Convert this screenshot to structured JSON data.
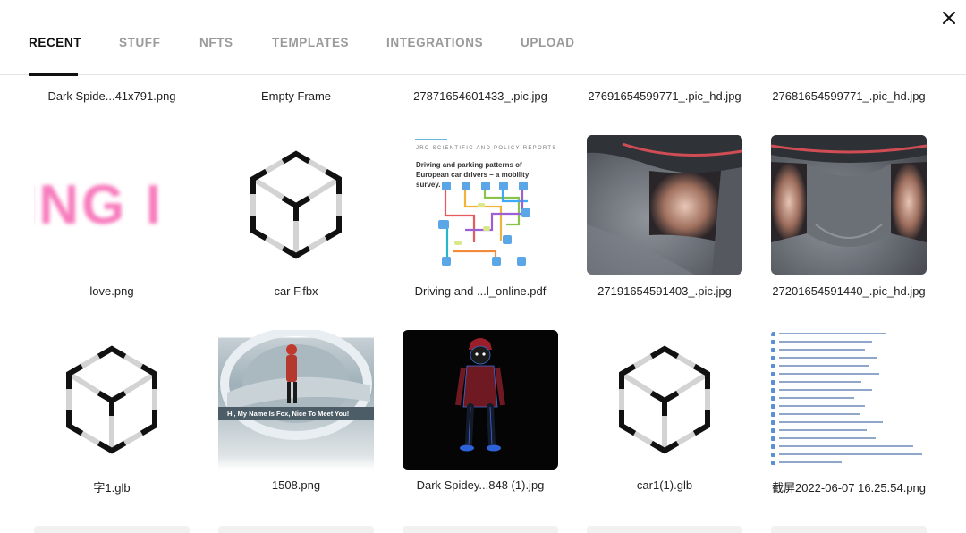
{
  "tabs": [
    {
      "label": "RECENT",
      "active": true
    },
    {
      "label": "STUFF",
      "active": false
    },
    {
      "label": "NFTS",
      "active": false
    },
    {
      "label": "TEMPLATES",
      "active": false
    },
    {
      "label": "INTEGRATIONS",
      "active": false
    },
    {
      "label": "UPLOAD",
      "active": false
    }
  ],
  "close_icon": "close-icon",
  "top_labels": [
    "Dark Spide...41x791.png",
    "Empty Frame",
    "27871654601433_.pic.jpg",
    "27691654599771_.pic_hd.jpg",
    "27681654599771_.pic_hd.jpg"
  ],
  "files_row1": [
    {
      "name": "love.png",
      "thumb_text": "ING I"
    },
    {
      "name": "car F.fbx",
      "icon": "3d-model-icon"
    },
    {
      "name": "Driving and ...l_online.pdf",
      "pdf_header": "JRC SCIENTIFIC AND POLICY REPORTS",
      "pdf_title": "Driving and parking patterns of European car drivers – a mobility survey."
    },
    {
      "name": "27191654591403_.pic.jpg"
    },
    {
      "name": "27201654591440_.pic_hd.jpg"
    }
  ],
  "files_row2": [
    {
      "name": "字1.glb",
      "icon": "3d-model-icon"
    },
    {
      "name": "1508.png",
      "caption": "Hi, My Name Is Fox, Nice To Meet You!"
    },
    {
      "name": "Dark Spidey...848 (1).jpg"
    },
    {
      "name": "car1(1).glb",
      "icon": "3d-model-icon"
    },
    {
      "name": "截屏2022-06-07 16.25.54.png"
    }
  ]
}
